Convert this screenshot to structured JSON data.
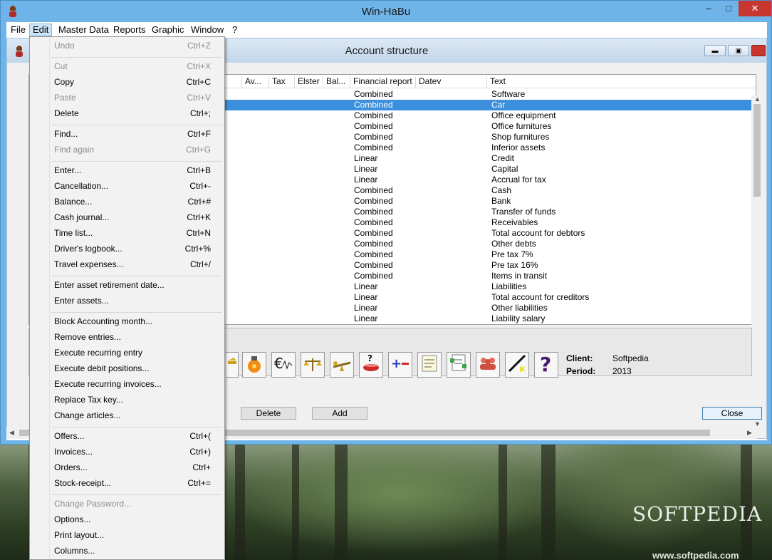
{
  "app_title": "Win-HaBu",
  "menu_bar": [
    "File",
    "Edit",
    "Master Data",
    "Reports",
    "Graphic",
    "Window",
    "?"
  ],
  "child_window": {
    "title": "Account structure"
  },
  "grid": {
    "columns": [
      "Av...",
      "Tax",
      "Elster",
      "Bal...",
      "Financial report",
      "Datev",
      "Text"
    ],
    "rows": [
      {
        "report": "Combined",
        "text": "Software"
      },
      {
        "report": "Combined",
        "text": "Car"
      },
      {
        "report": "Combined",
        "text": "Office equipment"
      },
      {
        "report": "Combined",
        "text": "Office furnitures"
      },
      {
        "report": "Combined",
        "text": "Shop furnitures"
      },
      {
        "report": "Combined",
        "text": "Inferior assets"
      },
      {
        "report": "Linear",
        "text": "Credit"
      },
      {
        "report": "Linear",
        "text": "Capital"
      },
      {
        "report": "Linear",
        "text": "Accrual for tax"
      },
      {
        "report": "Combined",
        "text": "Cash"
      },
      {
        "report": "Combined",
        "text": "Bank"
      },
      {
        "report": "Combined",
        "text": "Transfer of funds"
      },
      {
        "report": "Combined",
        "text": "Receivables"
      },
      {
        "report": "Combined",
        "text": "Total account for debtors"
      },
      {
        "report": "Combined",
        "text": "Other debts"
      },
      {
        "report": "Combined",
        "text": "Pre tax 7%"
      },
      {
        "report": "Combined",
        "text": "Pre tax 16%"
      },
      {
        "report": "Combined",
        "text": "Items in transit"
      },
      {
        "report": "Linear",
        "text": "Liabilities"
      },
      {
        "report": "Linear",
        "text": "Total account for creditors"
      },
      {
        "report": "Linear",
        "text": "Other liabilities"
      },
      {
        "report": "Linear",
        "text": "Liability salary"
      }
    ],
    "selected_index": 1
  },
  "toolbar": {
    "client_label": "Client:",
    "client_value": "Softpedia",
    "period_label": "Period:",
    "period_value": "2013",
    "icons": [
      "cash-register-icon",
      "coin-bag-icon",
      "euro-signal-icon",
      "scales-icon",
      "seesaw-icon",
      "question-pot-icon",
      "plus-minus-icon",
      "form-icon",
      "document-stack-icon",
      "people-icon",
      "magic-wand-icon",
      "help-icon"
    ]
  },
  "buttons": {
    "delete": "Delete",
    "add": "Add",
    "close": "Close"
  },
  "edit_menu": [
    {
      "label": "Undo",
      "shortcut": "Ctrl+Z",
      "disabled": true
    },
    {
      "sep": true
    },
    {
      "label": "Cut",
      "shortcut": "Ctrl+X",
      "disabled": true
    },
    {
      "label": "Copy",
      "shortcut": "Ctrl+C",
      "disabled": false
    },
    {
      "label": "Paste",
      "shortcut": "Ctrl+V",
      "disabled": true
    },
    {
      "label": "Delete",
      "shortcut": "Ctrl+;",
      "disabled": false
    },
    {
      "sep": true
    },
    {
      "label": "Find...",
      "shortcut": "Ctrl+F",
      "disabled": false
    },
    {
      "label": "Find again",
      "shortcut": "Ctrl+G",
      "disabled": true
    },
    {
      "sep": true
    },
    {
      "label": "Enter...",
      "shortcut": "Ctrl+B",
      "disabled": false
    },
    {
      "label": "Cancellation...",
      "shortcut": "Ctrl+-",
      "disabled": false
    },
    {
      "label": "Balance...",
      "shortcut": "Ctrl+#",
      "disabled": false
    },
    {
      "label": "Cash journal...",
      "shortcut": "Ctrl+K",
      "disabled": false
    },
    {
      "label": "Time list...",
      "shortcut": "Ctrl+N",
      "disabled": false
    },
    {
      "label": "Driver's logbook...",
      "shortcut": "Ctrl+%",
      "disabled": false
    },
    {
      "label": "Travel expenses...",
      "shortcut": "Ctrl+/",
      "disabled": false
    },
    {
      "sep": true
    },
    {
      "label": "Enter asset retirement date...",
      "shortcut": "",
      "disabled": false
    },
    {
      "label": "Enter assets...",
      "shortcut": "",
      "disabled": false
    },
    {
      "sep": true
    },
    {
      "label": "Block Accounting month...",
      "shortcut": "",
      "disabled": false
    },
    {
      "label": "Remove entries...",
      "shortcut": "",
      "disabled": false
    },
    {
      "label": "Execute recurring entry",
      "shortcut": "",
      "disabled": false
    },
    {
      "label": "Execute debit positions...",
      "shortcut": "",
      "disabled": false
    },
    {
      "label": "Execute recurring invoices...",
      "shortcut": "",
      "disabled": false
    },
    {
      "label": "Replace Tax key...",
      "shortcut": "",
      "disabled": false
    },
    {
      "label": "Change articles...",
      "shortcut": "",
      "disabled": false
    },
    {
      "sep": true
    },
    {
      "label": "Offers...",
      "shortcut": "Ctrl+(",
      "disabled": false
    },
    {
      "label": "Invoices...",
      "shortcut": "Ctrl+)",
      "disabled": false
    },
    {
      "label": "Orders...",
      "shortcut": "Ctrl+",
      "disabled": false
    },
    {
      "label": "Stock-receipt...",
      "shortcut": "Ctrl+=",
      "disabled": false
    },
    {
      "sep": true
    },
    {
      "label": "Change Password...",
      "shortcut": "",
      "disabled": true
    },
    {
      "label": "Options...",
      "shortcut": "",
      "disabled": false
    },
    {
      "label": "Print layout...",
      "shortcut": "",
      "disabled": false
    },
    {
      "label": "Columns...",
      "shortcut": "",
      "disabled": false
    }
  ],
  "watermark": {
    "logo": "SOFTPEDIA",
    "url": "www.softpedia.com"
  }
}
